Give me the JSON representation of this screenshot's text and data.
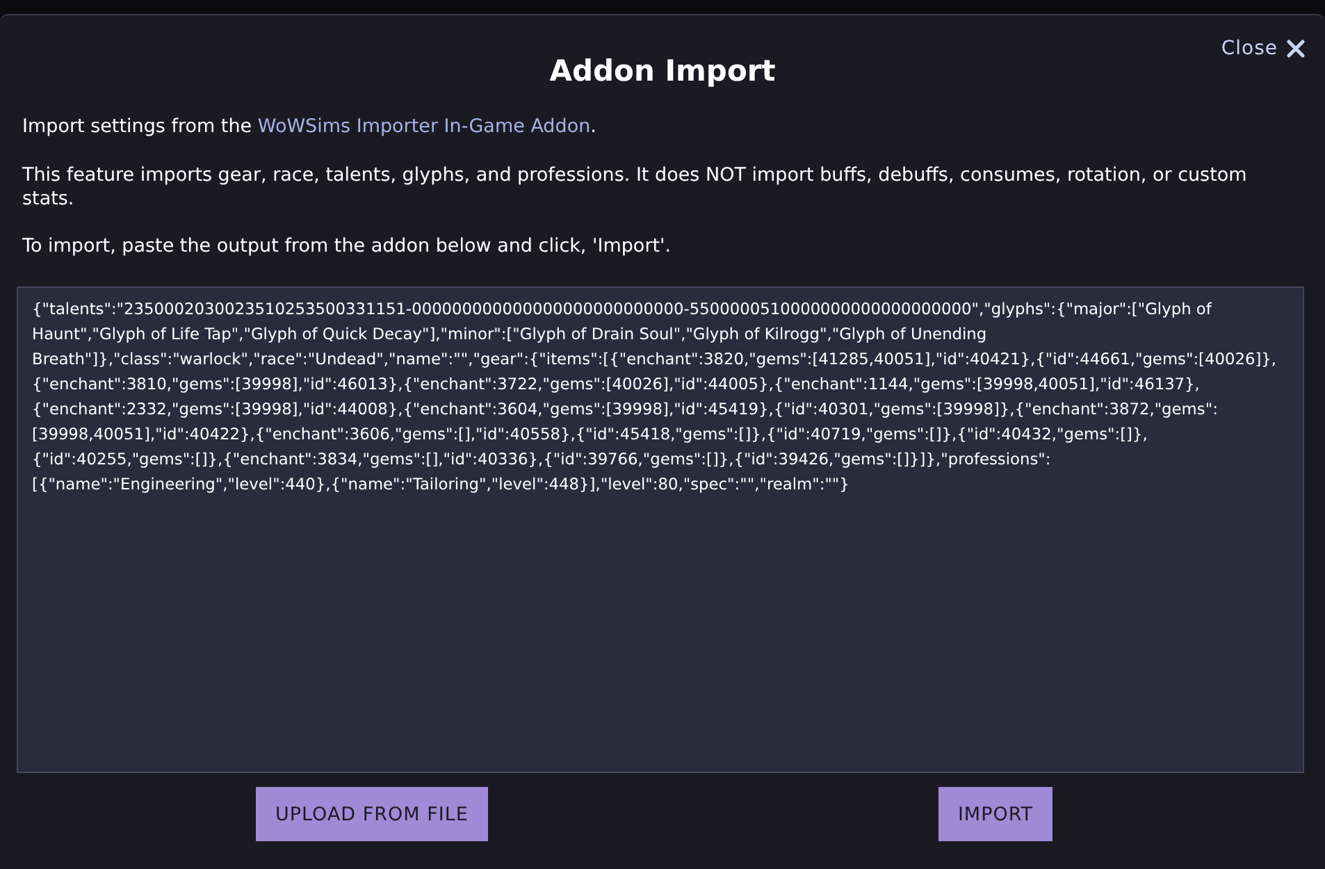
{
  "dialog": {
    "title": "Addon Import",
    "close_label": "Close",
    "intro": {
      "before": "Import settings from the ",
      "link": "WoWSims Importer In-Game Addon",
      "after": "."
    },
    "note": "This feature imports gear, race, talents, glyphs, and professions. It does NOT import buffs, debuffs, consumes, rotation, or custom stats.",
    "instructions": "To import, paste the output from the addon below and click, 'Import'.",
    "input_value": "{\"talents\":\"2350002030023510253500331151-000000000000000000000000000-5500000510000000000000000000\",\"glyphs\":{\"major\":[\"Glyph of Haunt\",\"Glyph of Life Tap\",\"Glyph of Quick Decay\"],\"minor\":[\"Glyph of Drain Soul\",\"Glyph of Kilrogg\",\"Glyph of Unending Breath\"]},\"class\":\"warlock\",\"race\":\"Undead\",\"name\":\"\",\"gear\":{\"items\":[{\"enchant\":3820,\"gems\":[41285,40051],\"id\":40421},{\"id\":44661,\"gems\":[40026]},{\"enchant\":3810,\"gems\":[39998],\"id\":46013},{\"enchant\":3722,\"gems\":[40026],\"id\":44005},{\"enchant\":1144,\"gems\":[39998,40051],\"id\":46137},{\"enchant\":2332,\"gems\":[39998],\"id\":44008},{\"enchant\":3604,\"gems\":[39998],\"id\":45419},{\"id\":40301,\"gems\":[39998]},{\"enchant\":3872,\"gems\":[39998,40051],\"id\":40422},{\"enchant\":3606,\"gems\":[],\"id\":40558},{\"id\":45418,\"gems\":[]},{\"id\":40719,\"gems\":[]},{\"id\":40432,\"gems\":[]},{\"id\":40255,\"gems\":[]},{\"enchant\":3834,\"gems\":[],\"id\":40336},{\"id\":39766,\"gems\":[]},{\"id\":39426,\"gems\":[]}]},\"professions\":[{\"name\":\"Engineering\",\"level\":440},{\"name\":\"Tailoring\",\"level\":448}],\"level\":80,\"spec\":\"\",\"realm\":\"\"}",
    "buttons": [
      {
        "label": "UPLOAD FROM FILE"
      },
      {
        "label": "IMPORT"
      }
    ]
  }
}
